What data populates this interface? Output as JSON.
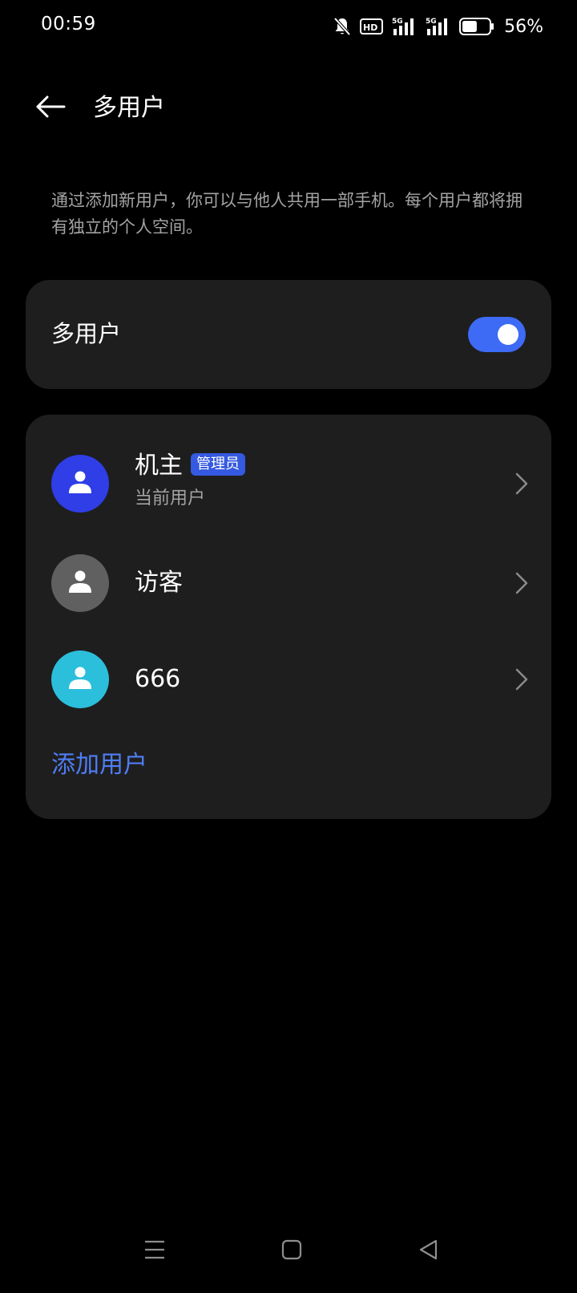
{
  "status_bar": {
    "time": "00:59",
    "battery_percent": "56%",
    "battery_level": 0.56,
    "icons": [
      "bell-off-icon",
      "hd-icon",
      "signal-5g-icon",
      "signal-5g-icon",
      "battery-icon"
    ],
    "network_label": "5G",
    "hd_label": "HD"
  },
  "header": {
    "back_icon": "arrow-left-icon",
    "title": "多用户"
  },
  "description": "通过添加新用户，你可以与他人共用一部手机。每个用户都将拥有独立的个人空间。",
  "toggle_card": {
    "label": "多用户",
    "enabled": true,
    "accent": "#3d6bf6"
  },
  "users": [
    {
      "name": "机主",
      "badge": "管理员",
      "subtitle": "当前用户",
      "avatar_color": "#2f3ee6",
      "icon": "person-icon"
    },
    {
      "name": "访客",
      "avatar_color": "#606060",
      "icon": "person-icon"
    },
    {
      "name": "666",
      "avatar_color": "#2cbfdb",
      "icon": "person-icon"
    }
  ],
  "add_user_label": "添加用户",
  "nav_bar": {
    "icons": [
      "menu-icon",
      "home-square-icon",
      "back-triangle-icon"
    ]
  }
}
